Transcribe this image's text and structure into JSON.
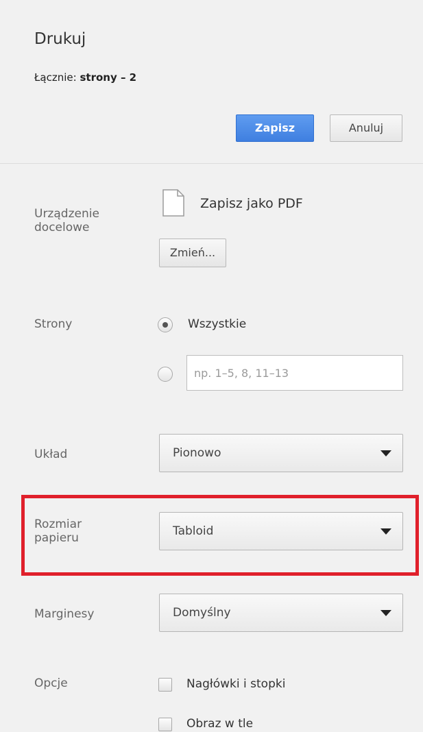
{
  "header": {
    "title": "Drukuj",
    "summary_prefix": "Łącznie: ",
    "summary_pages": "strony – 2",
    "save_label": "Zapisz",
    "cancel_label": "Anuluj"
  },
  "destination": {
    "label_line1": "Urządzenie",
    "label_line2": "docelowe",
    "icon": "document-icon",
    "name": "Zapisz jako PDF",
    "change_label": "Zmień..."
  },
  "pages": {
    "label": "Strony",
    "all_label": "Wszystkie",
    "all_selected": true,
    "custom_placeholder": "np. 1–5, 8, 11–13"
  },
  "layout": {
    "label": "Układ",
    "value": "Pionowo"
  },
  "paper_size": {
    "label_line1": "Rozmiar",
    "label_line2": "papieru",
    "value": "Tabloid",
    "highlight_color": "#e0202b"
  },
  "margins": {
    "label": "Marginesy",
    "value": "Domyślny"
  },
  "options": {
    "label": "Opcje",
    "headers_footers_label": "Nagłówki i stopki",
    "background_label": "Obraz w tle"
  },
  "colors": {
    "primary_button": "#4285f4",
    "background": "#f1f1f1"
  }
}
